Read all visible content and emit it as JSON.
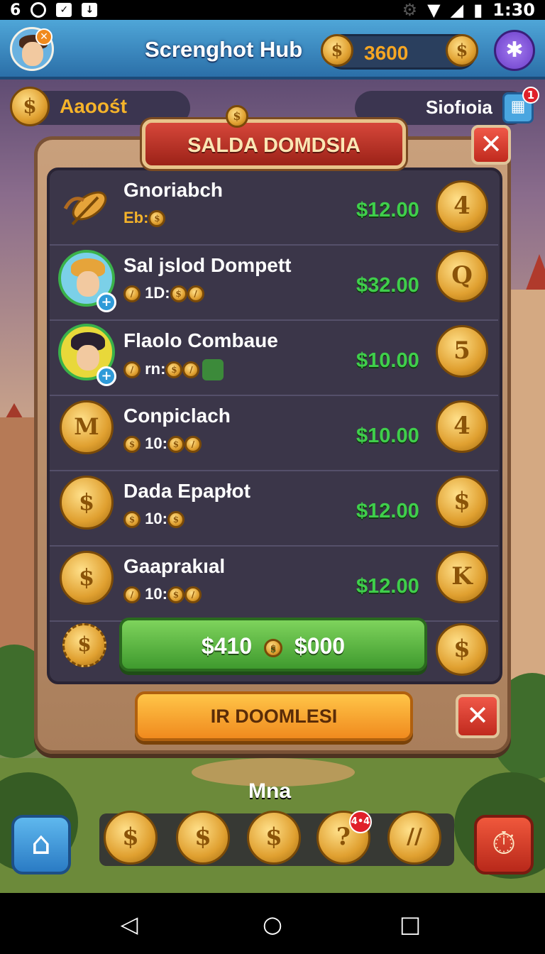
{
  "status_bar": {
    "left_text": "6",
    "time": "1:30"
  },
  "header": {
    "title": "Screnghot Hub",
    "coins": "3600",
    "avatar_badge": "✕"
  },
  "subheader": {
    "left_label": "Aaoośt",
    "right_label": "Siofıoia",
    "right_badge": "1"
  },
  "dialog": {
    "title": "SALDA DOMDSIA",
    "items": [
      {
        "name": "Gnoriabch",
        "sub_prefix": "Eb:",
        "price": "$12.00",
        "coin_glyph": "4"
      },
      {
        "name": "Sal jslod Dompett",
        "sub_prefix": "1D:",
        "price": "$32.00",
        "coin_glyph": "Q"
      },
      {
        "name": "Flaolo Combaue",
        "sub_prefix": "rn:",
        "price": "$10.00",
        "coin_glyph": "5"
      },
      {
        "name": "Conpiclach",
        "sub_prefix": "10:",
        "price": "$10.00",
        "coin_glyph": "4"
      },
      {
        "name": "Dada Epapłot",
        "sub_prefix": "10:",
        "price": "$12.00",
        "coin_glyph": "$"
      },
      {
        "name": "Gaaprakıal",
        "sub_prefix": "10:",
        "price": "$12.00",
        "coin_glyph": "K"
      }
    ],
    "green_button": {
      "left": "$410",
      "right": "$000"
    },
    "orange_button": "IR DOOMLESI"
  },
  "bottom": {
    "label": "Mna",
    "question_badge": "4•4"
  },
  "colors": {
    "price_green": "#3fcf4b",
    "gold": "#f5b32a",
    "header_blue": "#2b6fa8"
  }
}
